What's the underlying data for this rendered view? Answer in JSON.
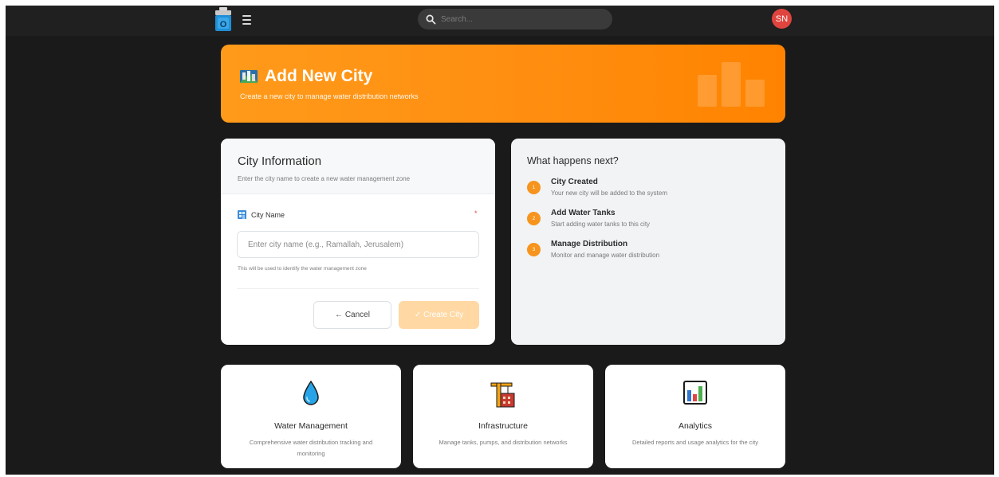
{
  "topbar": {
    "search_placeholder": "Search...",
    "avatar_initials": "SN",
    "avatar_color": "#e0443e"
  },
  "hero": {
    "title": "Add New City",
    "subtitle": "Create a new city to manage water distribution networks",
    "icon": "city-map-icon",
    "accent": "#ff8e10"
  },
  "city_form": {
    "title": "City Information",
    "description": "Enter the city name to create a new water management zone",
    "field_label": "City Name",
    "required_mark": "*",
    "input_value": "",
    "input_placeholder": "Enter city name (e.g., Ramallah, Jerusalem)",
    "hint": "This will be used to identify the water management zone",
    "cancel_label": "← Cancel",
    "create_label": "✓ Create City"
  },
  "next_steps": {
    "title": "What happens next?",
    "steps": [
      {
        "num": "1",
        "title": "City Created",
        "desc": "Your new city will be added to the system"
      },
      {
        "num": "2",
        "title": "Add Water Tanks",
        "desc": "Start adding water tanks to this city"
      },
      {
        "num": "3",
        "title": "Manage Distribution",
        "desc": "Monitor and manage water distribution"
      }
    ]
  },
  "features": [
    {
      "icon": "water-drop-icon",
      "title": "Water Management",
      "desc": "Comprehensive water distribution tracking and monitoring"
    },
    {
      "icon": "construction-crane-icon",
      "title": "Infrastructure",
      "desc": "Manage tanks, pumps, and distribution networks"
    },
    {
      "icon": "bar-chart-icon",
      "title": "Analytics",
      "desc": "Detailed reports and usage analytics for the city"
    }
  ]
}
